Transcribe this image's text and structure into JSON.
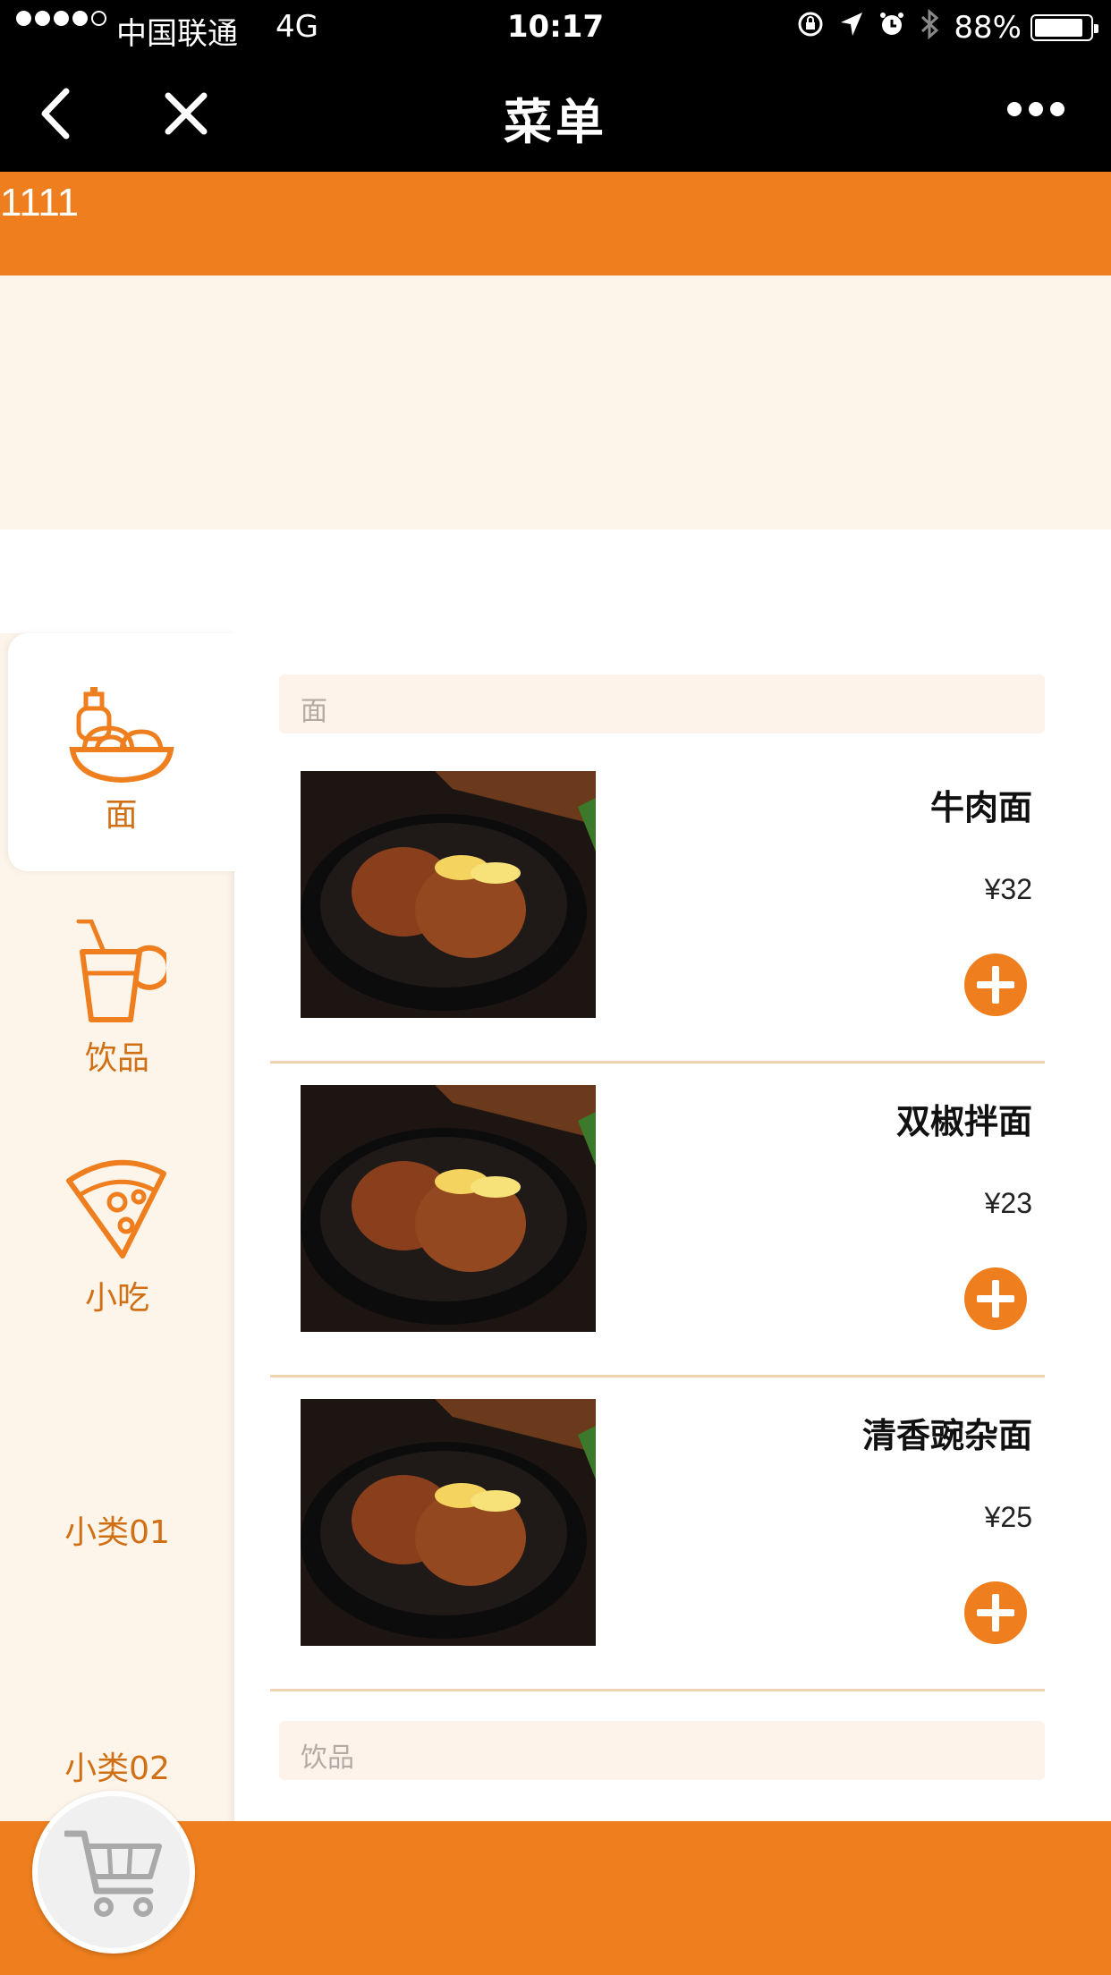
{
  "status_bar": {
    "carrier": "中国联通",
    "network": "4G",
    "time": "10:17",
    "battery": "88%",
    "battery_level": 0.88,
    "icons": [
      "orientation-lock-icon",
      "location-icon",
      "alarm-icon",
      "bluetooth-icon",
      "battery-icon"
    ]
  },
  "nav": {
    "title": "菜单",
    "back_icon": "chevron-left-icon",
    "close_icon": "close-icon",
    "more_icon": "more-dots-icon"
  },
  "notice": {
    "text": "1111"
  },
  "sidebar": {
    "items": [
      {
        "label": "面",
        "icon": "noodles-icon",
        "active": true
      },
      {
        "label": "饮品",
        "icon": "drink-icon",
        "active": false
      },
      {
        "label": "小吃",
        "icon": "pizza-icon",
        "active": false
      },
      {
        "label": "小类01",
        "icon": "",
        "active": false
      },
      {
        "label": "小类02",
        "icon": "",
        "active": false
      }
    ]
  },
  "menu": {
    "sections": [
      {
        "title": "面",
        "items": [
          {
            "name": "牛肉面",
            "price": "¥32"
          },
          {
            "name": "双椒拌面",
            "price": "¥23"
          },
          {
            "name": "清香豌杂面",
            "price": "¥25"
          }
        ]
      },
      {
        "title": "饮品",
        "items": []
      }
    ]
  },
  "cart": {
    "icon": "cart-icon"
  },
  "colors": {
    "accent": "#ef7f1e",
    "sidebar_bg": "#fdf5e9",
    "category_text": "#d16f14",
    "nav_bg": "#000000"
  }
}
